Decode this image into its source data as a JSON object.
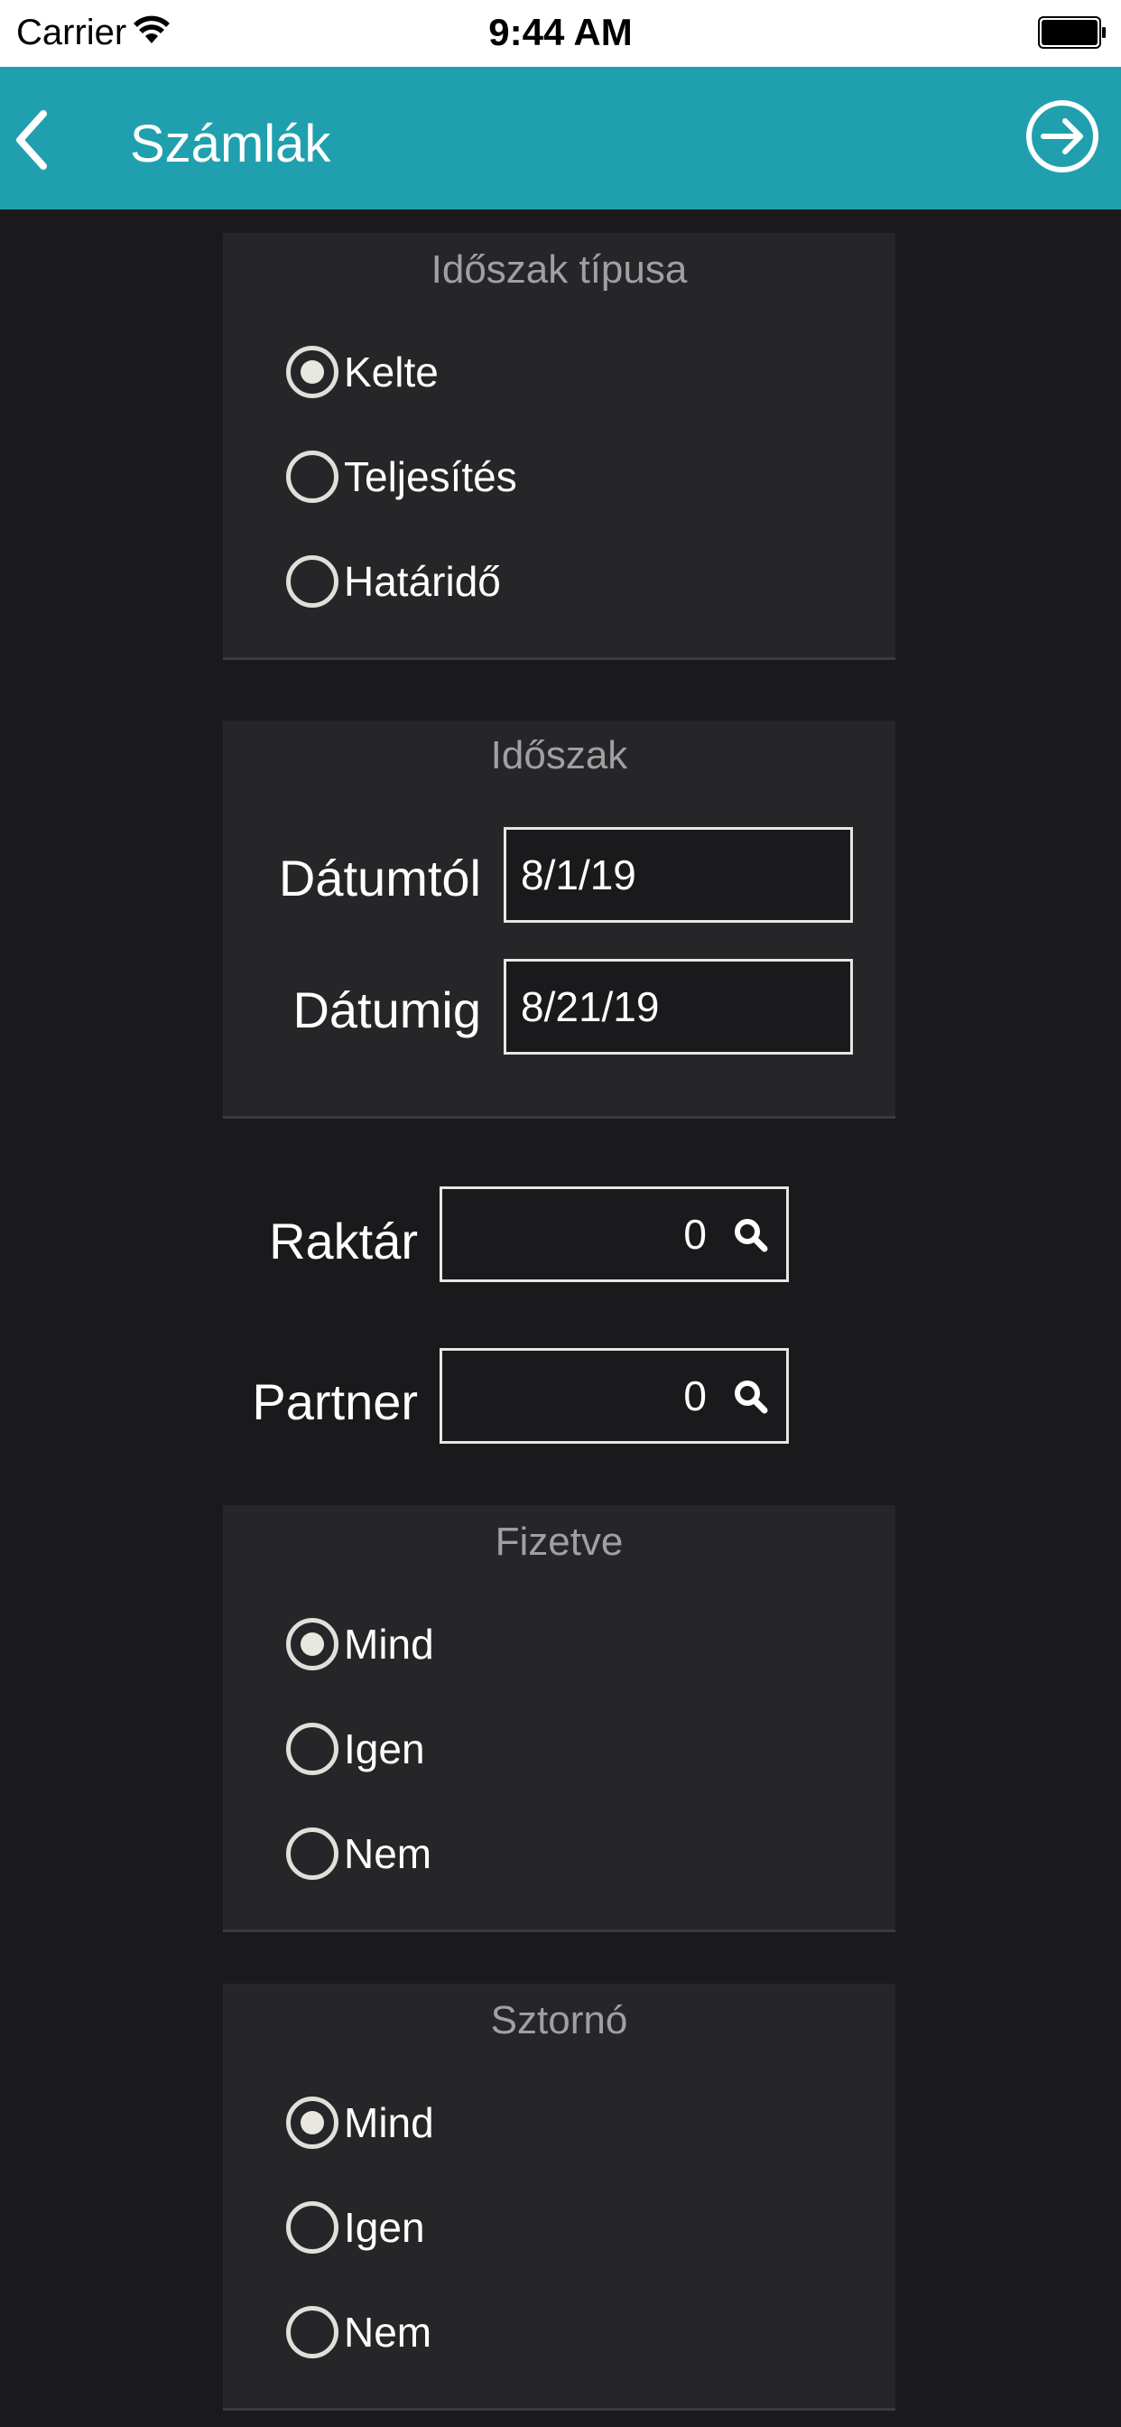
{
  "status_bar": {
    "carrier": "Carrier",
    "time": "9:44 AM"
  },
  "nav": {
    "title": "Számlák",
    "back_icon": "chevron-left-icon",
    "forward_icon": "arrow-right-circle-icon",
    "color": "#20a0ae"
  },
  "period_type": {
    "title": "Időszak típusa",
    "options": [
      "Kelte",
      "Teljesítés",
      "Határidő"
    ],
    "selected": "Kelte"
  },
  "period": {
    "title": "Időszak",
    "from_label": "Dátumtól",
    "from_value": "8/1/19",
    "to_label": "Dátumig",
    "to_value": "8/21/19"
  },
  "warehouse": {
    "label": "Raktár",
    "value": "0"
  },
  "partner": {
    "label": "Partner",
    "value": "0"
  },
  "paid": {
    "title": "Fizetve",
    "options": [
      "Mind",
      "Igen",
      "Nem"
    ],
    "selected": "Mind"
  },
  "storno": {
    "title": "Sztornó",
    "options": [
      "Mind",
      "Igen",
      "Nem"
    ],
    "selected": "Mind"
  }
}
